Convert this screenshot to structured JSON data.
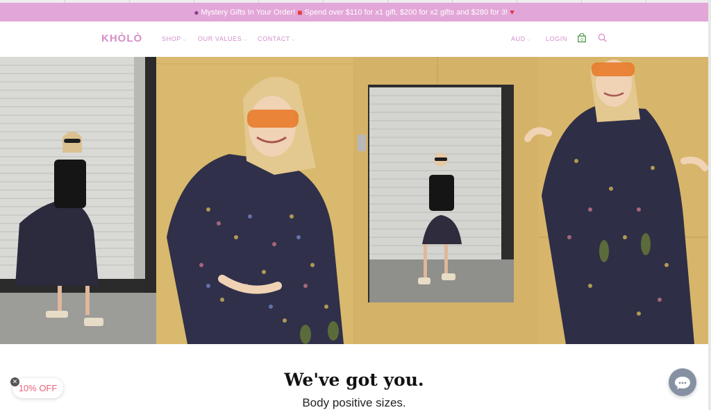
{
  "announcement": {
    "text_before": "Mystery Gifts In Your Order!",
    "text_after": "Spend over $110 for x1 gift, $200 for x2 gifts and $280 for 3!",
    "gem_icon": "crystal-ball-icon",
    "gift_icon": "gift-icon",
    "heart_icon": "heart-icon"
  },
  "header": {
    "logo": "KHÒLÒ",
    "nav": {
      "shop": "SHOP",
      "values": "OUR VALUES",
      "contact": "CONTACT"
    },
    "currency": "AUD",
    "login": "LOGIN",
    "cart_count": "0"
  },
  "hero": {
    "panels": [
      "woman-black-tee-floral-skirt",
      "woman-orange-sunglasses-floral-dress",
      "woman-full-length-shutter",
      "woman-floral-dress-yellow-wall"
    ]
  },
  "section": {
    "headline": "We've got you.",
    "subheadline": "Body positive sizes."
  },
  "popup": {
    "discount_label": "10% OFF",
    "close_symbol": "✕"
  },
  "colors": {
    "brand_pink": "#d58ec9",
    "announcement_bg": "#e3a6d8",
    "cart_green": "#3f8f3a",
    "discount_red": "#e8637a",
    "chat_bg": "#8591a3"
  }
}
